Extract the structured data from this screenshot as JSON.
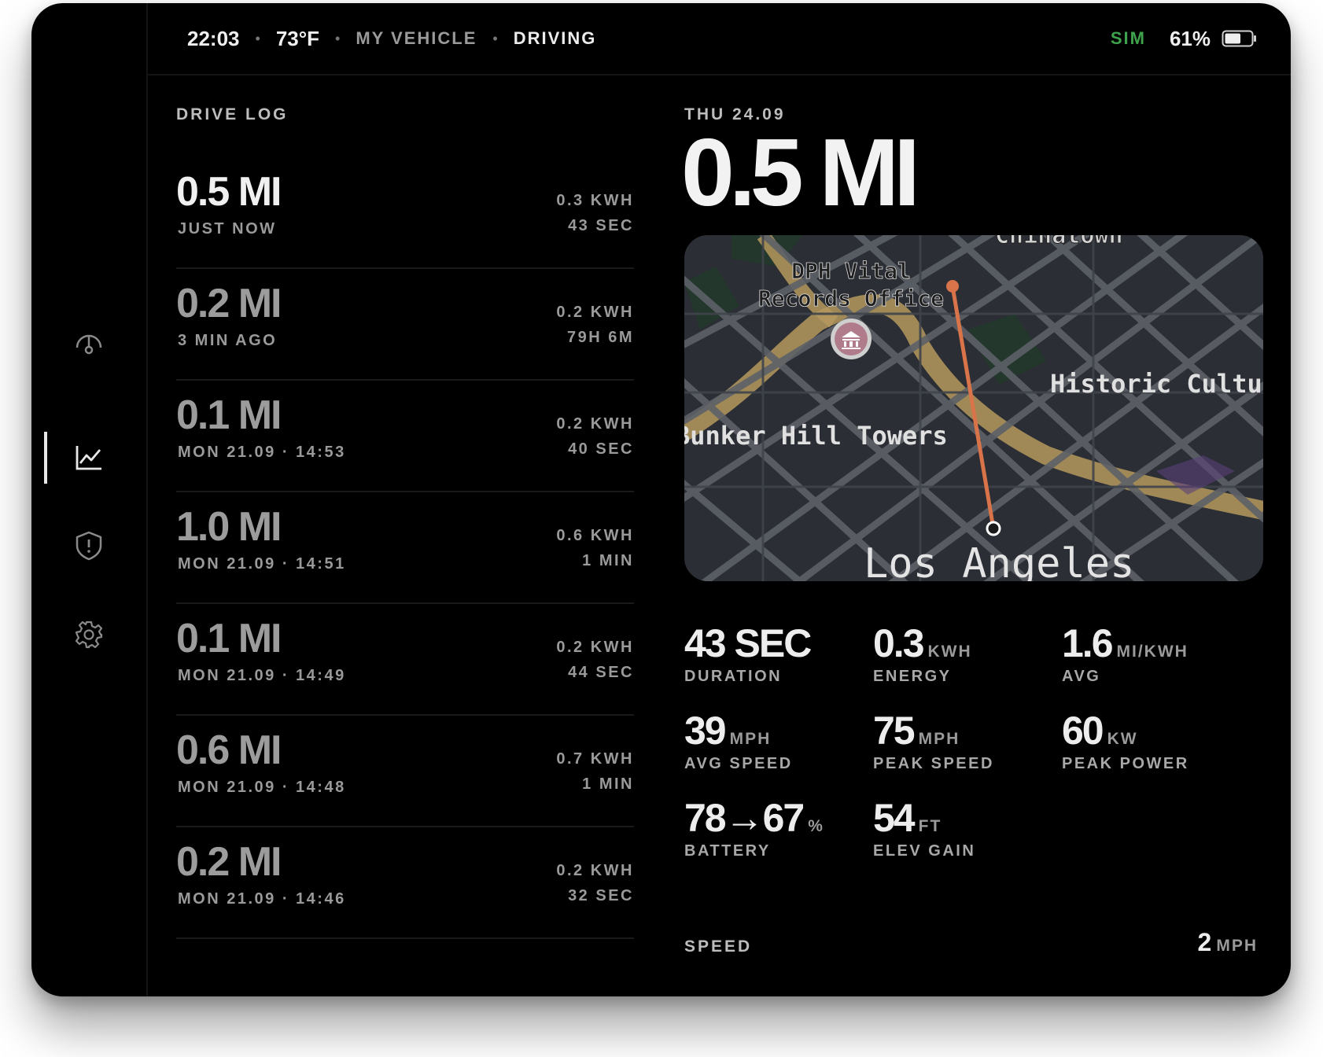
{
  "status_bar": {
    "time": "22:03",
    "temperature": "73°F",
    "vehicle": "MY VEHICLE",
    "state": "DRIVING",
    "sim_label": "SIM",
    "battery": "61%",
    "battery_level": 0.61
  },
  "sidebar": {
    "items": [
      {
        "name": "gauge-icon",
        "active": false
      },
      {
        "name": "chart-icon",
        "active": true
      },
      {
        "name": "shield-alert-icon",
        "active": false
      },
      {
        "name": "gear-icon",
        "active": false
      }
    ]
  },
  "drive_log": {
    "title": "DRIVE LOG",
    "entries": [
      {
        "distance": "0.5 MI",
        "when": "JUST NOW",
        "energy": "0.3 KWH",
        "duration": "43 SEC"
      },
      {
        "distance": "0.2 MI",
        "when": "3 MIN AGO",
        "energy": "0.2 KWH",
        "duration": "79H 6M"
      },
      {
        "distance": "0.1 MI",
        "when": "MON 21.09 · 14:53",
        "energy": "0.2 KWH",
        "duration": "40 SEC"
      },
      {
        "distance": "1.0 MI",
        "when": "MON 21.09 · 14:51",
        "energy": "0.6 KWH",
        "duration": "1 MIN"
      },
      {
        "distance": "0.1 MI",
        "when": "MON 21.09 · 14:49",
        "energy": "0.2 KWH",
        "duration": "44 SEC"
      },
      {
        "distance": "0.6 MI",
        "when": "MON 21.09 · 14:48",
        "energy": "0.7 KWH",
        "duration": "1 MIN"
      },
      {
        "distance": "0.2 MI",
        "when": "MON 21.09 · 14:46",
        "energy": "0.2 KWH",
        "duration": "32 SEC"
      }
    ]
  },
  "detail": {
    "date": "THU  24.09",
    "distance": "0.5 MI",
    "map": {
      "labels": {
        "chinatown": "Chinatown",
        "dph_line1": "DPH Vital",
        "dph_line2": "Records Office",
        "historic": "Historic Cultura",
        "bunker": "Bunker Hill Towers",
        "los_angeles": "Los Angeles"
      },
      "route_color": "#d9744a"
    },
    "stats": [
      {
        "value": "43 SEC",
        "unit": "",
        "label": "DURATION"
      },
      {
        "value": "0.3",
        "unit": "KWH",
        "label": "ENERGY"
      },
      {
        "value": "1.6",
        "unit": "MI/KWH",
        "label": "AVG"
      },
      {
        "value": "39",
        "unit": "MPH",
        "label": "AVG SPEED"
      },
      {
        "value": "75",
        "unit": "MPH",
        "label": "PEAK SPEED"
      },
      {
        "value": "60",
        "unit": "KW",
        "label": "PEAK POWER"
      },
      {
        "value": "78→67",
        "unit": "%",
        "label": "BATTERY"
      },
      {
        "value": "54",
        "unit": "FT",
        "label": "ELEV GAIN"
      }
    ],
    "speed": {
      "label": "SPEED",
      "value": "2",
      "unit": "MPH"
    }
  },
  "colors": {
    "background": "#000000",
    "sim_green": "#3fa34d",
    "route": "#d9744a"
  }
}
